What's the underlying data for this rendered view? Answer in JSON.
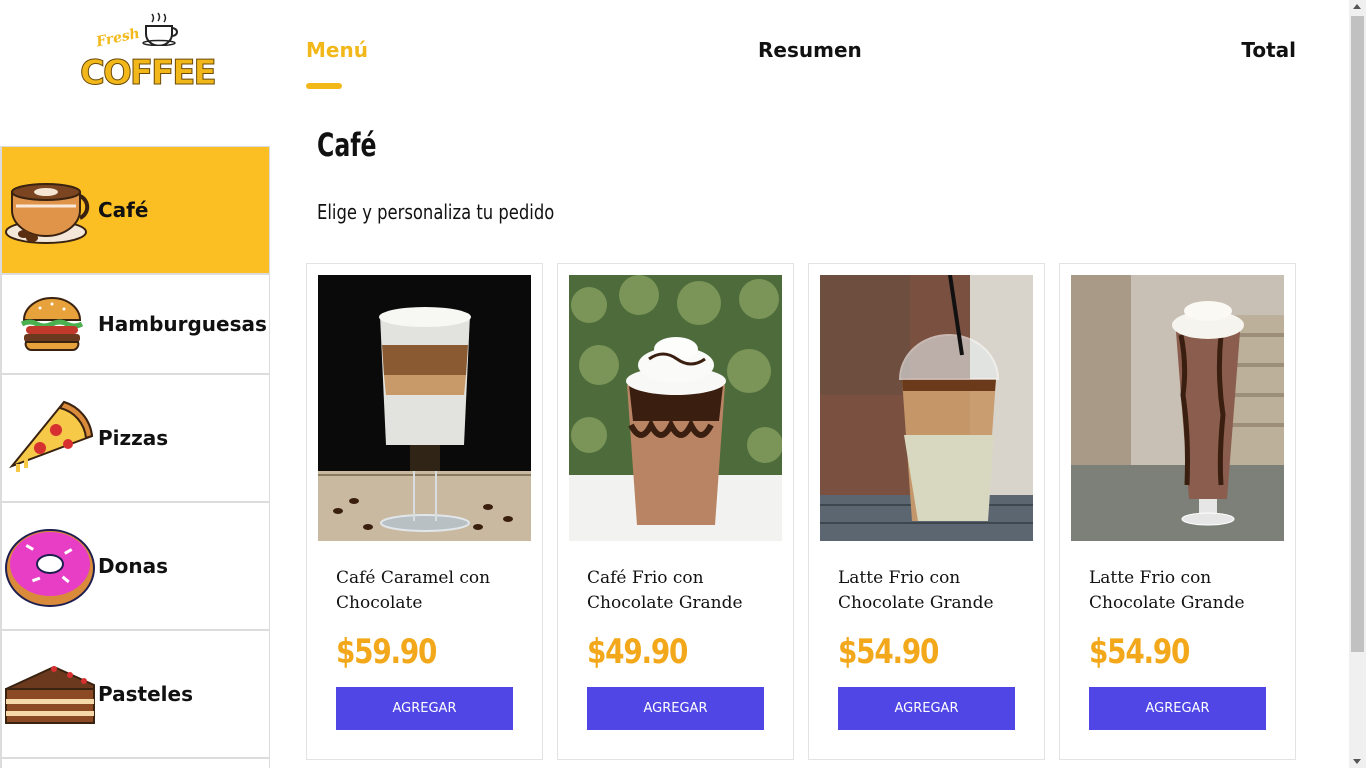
{
  "logo": {
    "line1": "Fresh",
    "line2": "COFFEE"
  },
  "categories": [
    {
      "label": "Café",
      "icon": "coffee-cup-icon",
      "active": true
    },
    {
      "label": "Hamburguesas",
      "icon": "burger-icon",
      "active": false
    },
    {
      "label": "Pizzas",
      "icon": "pizza-slice-icon",
      "active": false
    },
    {
      "label": "Donas",
      "icon": "donut-icon",
      "active": false
    },
    {
      "label": "Pasteles",
      "icon": "cake-slice-icon",
      "active": false
    },
    {
      "label": "",
      "icon": "",
      "active": false
    }
  ],
  "nav": {
    "menu": "Menú",
    "resumen": "Resumen",
    "total": "Total"
  },
  "section": {
    "title": "Café",
    "subtitle": "Elige y personaliza tu pedido"
  },
  "products": [
    {
      "name": "Café Caramel con Chocolate",
      "price": "$59.90",
      "button": "AGREGAR"
    },
    {
      "name": "Café Frio con Chocolate Grande",
      "price": "$49.90",
      "button": "AGREGAR"
    },
    {
      "name": "Latte Frio con Chocolate Grande",
      "price": "$54.90",
      "button": "AGREGAR"
    },
    {
      "name": "Latte Frio con Chocolate Grande",
      "price": "$54.90",
      "button": "AGREGAR"
    }
  ],
  "colors": {
    "accent": "#FBBF24",
    "price": "#F2A81A",
    "button": "#4F46E5"
  }
}
